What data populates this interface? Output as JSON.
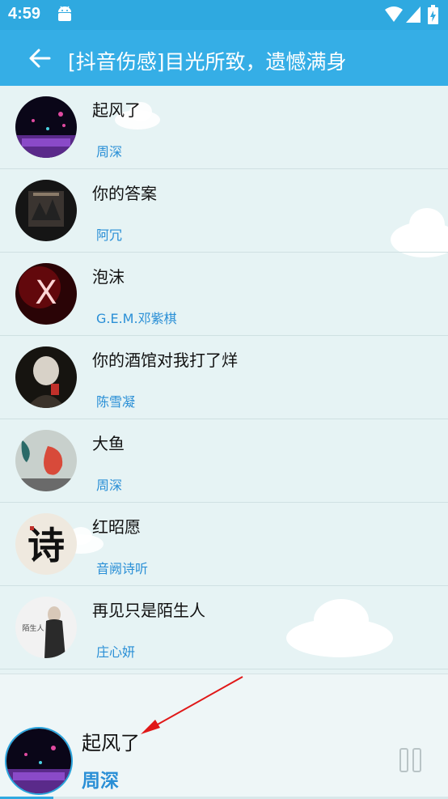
{
  "status_bar": {
    "time": "4:59"
  },
  "toolbar": {
    "title": "[抖音伤感]目光所致，遗憾满身"
  },
  "songs": [
    {
      "title": "起风了",
      "artist": "周深"
    },
    {
      "title": "你的答案",
      "artist": "阿冗"
    },
    {
      "title": "泡沫",
      "artist": "G.E.M.邓紫棋"
    },
    {
      "title": "你的酒馆对我打了烊",
      "artist": "陈雪凝"
    },
    {
      "title": "大鱼",
      "artist": "周深"
    },
    {
      "title": "红昭愿",
      "artist": "音阙诗听"
    },
    {
      "title": "再见只是陌生人",
      "artist": "庄心妍"
    }
  ],
  "avatars": {
    "2": {
      "glyph": "X"
    },
    "5": {
      "glyph": "诗"
    },
    "6": {
      "glyph": "陌生人"
    }
  },
  "player": {
    "title": "起风了",
    "artist": "周深",
    "progress": 0.12
  },
  "colors": {
    "status_bar": "#2fa9e0",
    "toolbar": "#35aee6",
    "accent": "#2a8fd6",
    "background": "#e6f3f4"
  }
}
